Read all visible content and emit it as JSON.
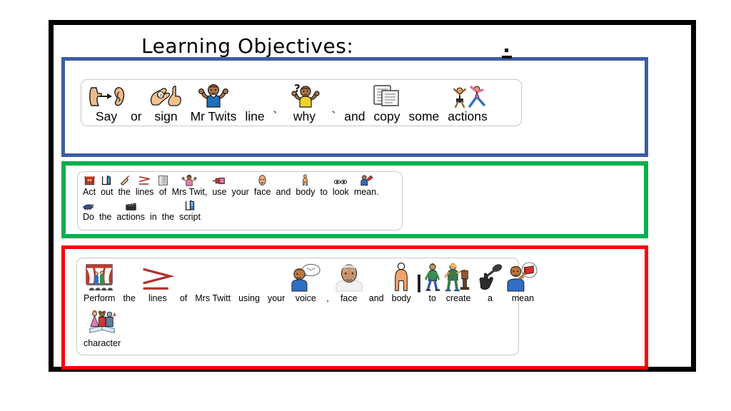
{
  "slide": {
    "title": "Learning Objectives:",
    "title_mark": ":",
    "frame_color": "#000000",
    "background": "#ffffff"
  },
  "objectives": [
    {
      "id": "objective-blue",
      "border_color": "#3b5ea5",
      "lines": [
        {
          "id": "blue-line-1",
          "symbols": [
            {
              "word": "Say",
              "icon": "say-mouth-ear-icon"
            },
            {
              "word": "or",
              "icon": "none"
            },
            {
              "word": "sign",
              "icon": "sign-hands-icon"
            },
            {
              "word": "Mr Twits",
              "icon": "man-shrug-blue-icon"
            },
            {
              "word": "line",
              "icon": "none"
            },
            {
              "word": "`",
              "icon": "none"
            },
            {
              "word": "why",
              "icon": "question-man-yellow-icon"
            },
            {
              "word": "`",
              "icon": "none"
            },
            {
              "word": "and",
              "icon": "none"
            },
            {
              "word": "copy",
              "icon": "copy-pages-icon"
            },
            {
              "word": "some",
              "icon": "none"
            },
            {
              "word": "actions",
              "icon": "actions-people-icon"
            }
          ]
        }
      ]
    },
    {
      "id": "objective-green",
      "border_color": "#00b050",
      "lines": [
        {
          "id": "green-line-1",
          "symbols": [
            {
              "word": "Act",
              "icon": "act-theatre-icon"
            },
            {
              "word": "out",
              "icon": "out-door-icon"
            },
            {
              "word": "the",
              "icon": "the-pointer-icon"
            },
            {
              "word": "lines",
              "icon": "lines-red-icon"
            },
            {
              "word": "of",
              "icon": "of-page-icon"
            },
            {
              "word": "Mrs Twit,",
              "icon": "woman-shrug-pink-icon"
            },
            {
              "word": "use",
              "icon": "use-tool-icon"
            },
            {
              "word": "your",
              "icon": "none"
            },
            {
              "word": "face",
              "icon": "face-icon"
            },
            {
              "word": "and",
              "icon": "none"
            },
            {
              "word": "body",
              "icon": "body-figure-icon"
            },
            {
              "word": "to",
              "icon": "none"
            },
            {
              "word": "look",
              "icon": "look-eyes-icon"
            },
            {
              "word": "mean.",
              "icon": "mean-person-red-icon"
            }
          ]
        },
        {
          "id": "green-line-2",
          "symbols": [
            {
              "word": "Do",
              "icon": "do-hand-icon"
            },
            {
              "word": "the",
              "icon": "none"
            },
            {
              "word": "actions",
              "icon": "actions-clapper-icon"
            },
            {
              "word": "in",
              "icon": "none"
            },
            {
              "word": "the",
              "icon": "none"
            },
            {
              "word": "script",
              "icon": "script-book-icon"
            }
          ]
        }
      ]
    },
    {
      "id": "objective-red",
      "border_color": "#ff0000",
      "lines": [
        {
          "id": "red-line-1",
          "symbols": [
            {
              "word": "Perform",
              "icon": "perform-stage-icon"
            },
            {
              "word": "the",
              "icon": "none"
            },
            {
              "word": "lines",
              "icon": "lines-red-icon"
            },
            {
              "word": "of",
              "icon": "none"
            },
            {
              "word": "Mrs Twitt",
              "icon": "none"
            },
            {
              "word": "using",
              "icon": "none"
            },
            {
              "word": "your",
              "icon": "none"
            },
            {
              "word": "voice",
              "icon": "voice-speech-icon"
            },
            {
              "word": ",",
              "icon": "none"
            },
            {
              "word": "face",
              "icon": "face-old-man-icon"
            },
            {
              "word": "and",
              "icon": "none"
            },
            {
              "word": "body",
              "icon": "body-orange-figure-icon"
            },
            {
              "word": "",
              "icon": "bar-divider-icon"
            },
            {
              "word": "to",
              "icon": "to-walking-icon"
            },
            {
              "word": "create",
              "icon": "create-sculptor-icon"
            },
            {
              "word": "a",
              "icon": "a-spoon-hand-icon"
            },
            {
              "word": "mean",
              "icon": "mean-thinking-book-icon"
            }
          ]
        },
        {
          "id": "red-line-2",
          "symbols": [
            {
              "word": "character",
              "icon": "character-storybook-icon"
            }
          ]
        }
      ]
    }
  ]
}
